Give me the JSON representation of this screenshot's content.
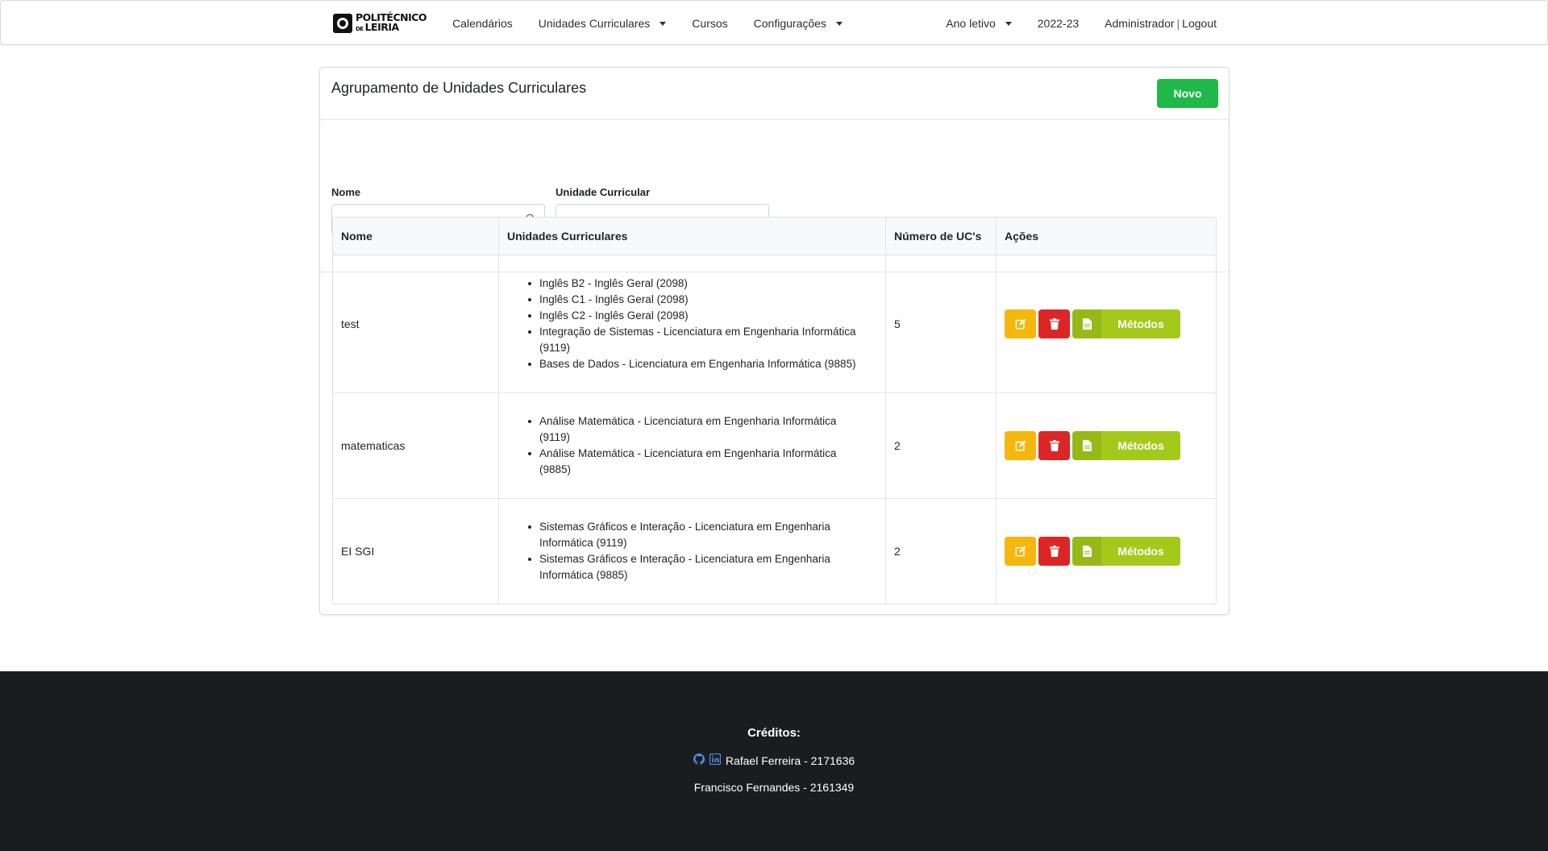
{
  "navbar": {
    "brand_line1": "POLITÉCNICO",
    "brand_line2_prefix": "DE",
    "brand_line2": "LEIRIA",
    "links": {
      "calendarios": "Calendários",
      "unidades": "Unidades Curriculares",
      "cursos": "Cursos",
      "configuracoes": "Configurações"
    },
    "ano_letivo_label": "Ano letivo",
    "ano_letivo_value": "2022-23",
    "user": "Administrador",
    "separator": "|",
    "logout": "Logout"
  },
  "card": {
    "title": "Agrupamento de Unidades Curriculares",
    "new_button": "Novo"
  },
  "filters": {
    "nome_label": "Nome",
    "nome_value": "",
    "uc_label": "Unidade Curricular",
    "uc_value": ""
  },
  "table": {
    "headers": [
      "Nome",
      "Unidades Curriculares",
      "Número de UC's",
      "Ações"
    ],
    "methods_label": "Métodos",
    "rows": [
      {
        "nome": "test",
        "ucs": [
          "Inglês B2 - Inglês Geral (2098)",
          "Inglês C1 - Inglês Geral (2098)",
          "Inglês C2 - Inglês Geral (2098)",
          "Integração de Sistemas - Licenciatura em Engenharia Informática (9119)",
          "Bases de Dados - Licenciatura em Engenharia Informática (9885)"
        ],
        "count": "5"
      },
      {
        "nome": "matematicas",
        "ucs": [
          "Análise Matemática - Licenciatura em Engenharia Informática (9119)",
          "Análise Matemática - Licenciatura em Engenharia Informática (9885)"
        ],
        "count": "2"
      },
      {
        "nome": "EI SGI",
        "ucs": [
          "Sistemas Gráficos e Interação - Licenciatura em Engenharia Informática (9119)",
          "Sistemas Gráficos e Interação - Licenciatura em Engenharia Informática (9885)"
        ],
        "count": "2"
      }
    ]
  },
  "footer": {
    "title": "Créditos:",
    "credit1": "Rafael Ferreira - 2171636",
    "credit2": "Francisco Fernandes - 2161349"
  },
  "icons": {
    "edit": "edit-icon",
    "delete": "trash-icon",
    "methods": "document-icon",
    "github": "github-icon",
    "linkedin": "linkedin-icon",
    "search": "search-icon"
  },
  "colors": {
    "novo": "#21b84a",
    "edit": "#f5b70c",
    "delete": "#dc2626",
    "methods": "#a4c91b",
    "footer_bg": "#1b1c1f",
    "icon_blue": "#4a90e2"
  }
}
